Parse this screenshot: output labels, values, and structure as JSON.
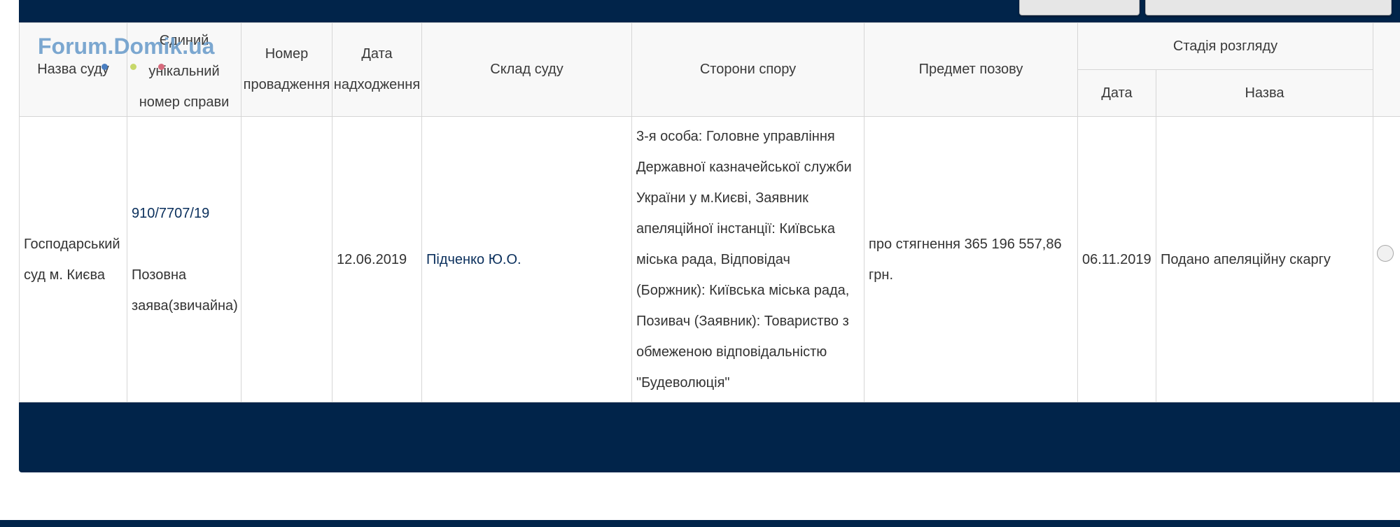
{
  "watermark": "Forum.Domik.ua",
  "headers": {
    "court_name": "Назва суду",
    "case_number": "Єдиний унікальний номер справи",
    "proceeding_number": "Номер провадження",
    "received_date": "Дата надходження",
    "court_composition": "Склад суду",
    "parties": "Сторони спору",
    "claim_subject": "Предмет позову",
    "stage_group": "Стадія розгляду",
    "stage_date": "Дата",
    "stage_name": "Назва"
  },
  "row": {
    "court_name": "Господарський суд м. Києва",
    "case_number": "910/7707/19",
    "case_type": "Позовна заява(звичайна)",
    "proceeding_number": "",
    "received_date": "12.06.2019",
    "court_composition": "Підченко Ю.О.",
    "parties": "3-я особа: Головне управління Державної казначейської служби України у м.Києві, Заявник апеляційної інстанції: Київська міська рада, Відповідач (Боржник): Київська міська рада, Позивач (Заявник): Товариство з обмеженою відповідальністю \"Будеволюція\"",
    "claim_subject": "про стягнення 365 196 557,86 грн.",
    "stage_date": "06.11.2019",
    "stage_name": "Подано апеляційну скаргу"
  },
  "colors": {
    "navy": "#01244a",
    "link": "#0a2f5c",
    "header_bg": "#f8f8f8",
    "border": "#d6d6d6"
  }
}
